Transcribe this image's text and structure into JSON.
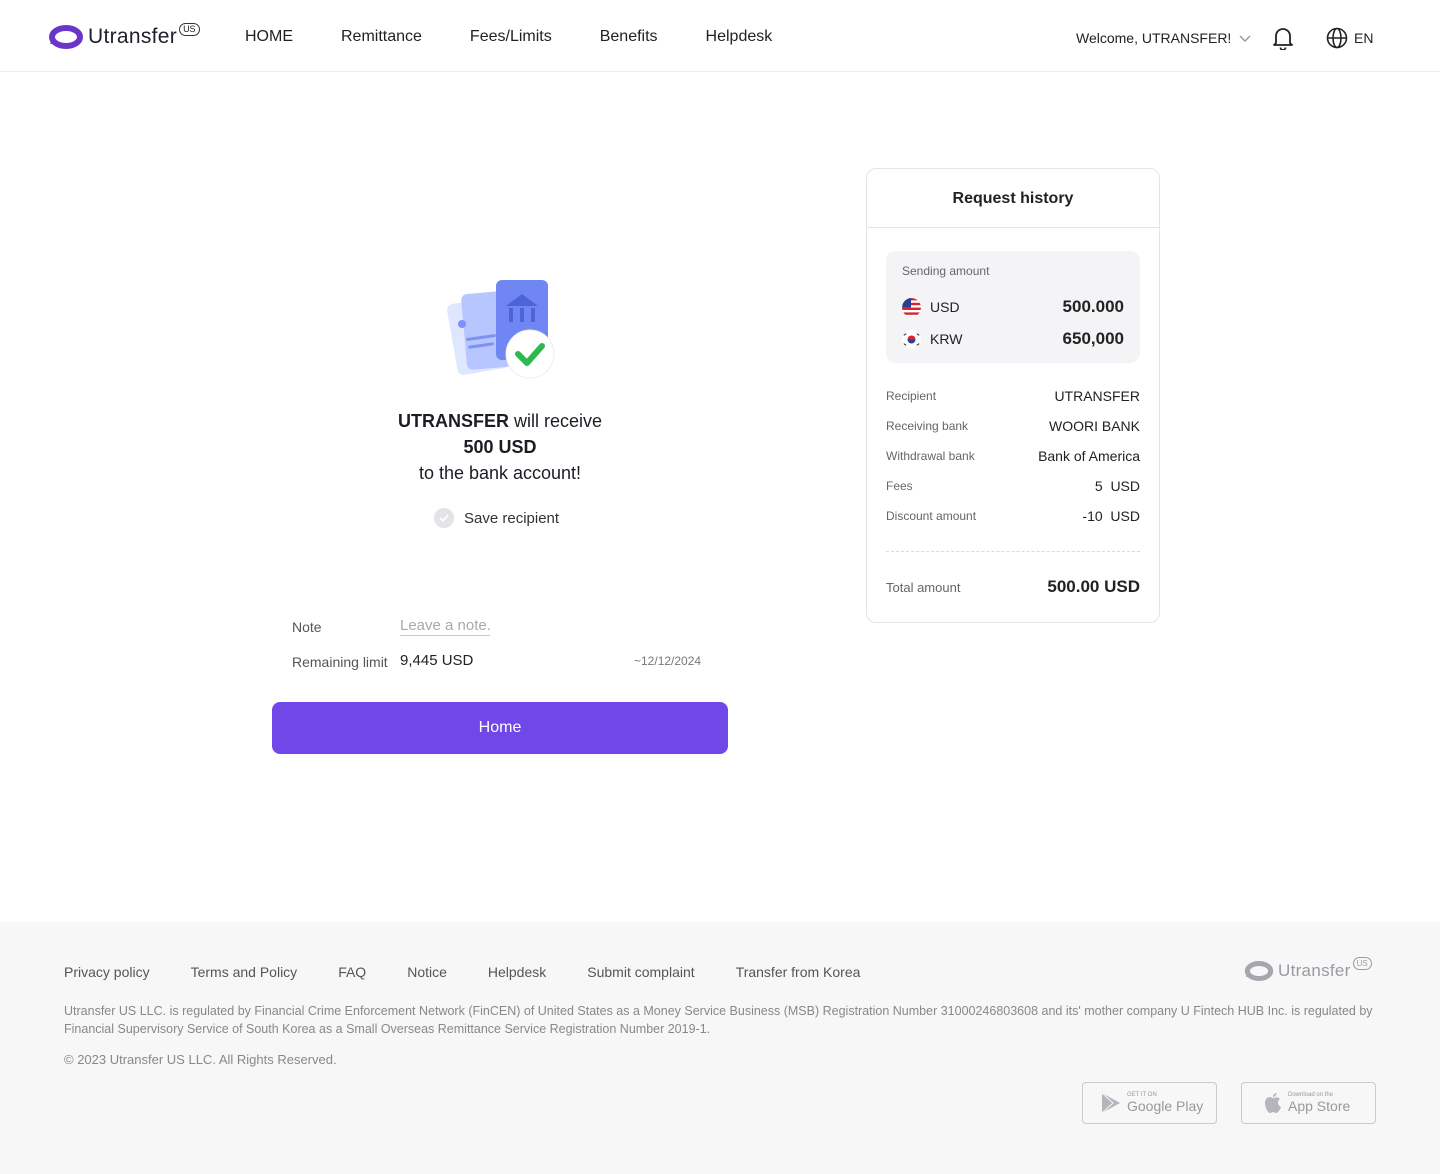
{
  "header": {
    "logo_text": "Utransfer",
    "logo_badge": "US",
    "nav": [
      "HOME",
      "Remittance",
      "Fees/Limits",
      "Benefits",
      "Helpdesk"
    ],
    "welcome": "Welcome, UTRANSFER!",
    "language": "EN"
  },
  "result": {
    "recipient_name": "UTRANSFER",
    "line1_rest": " will receive",
    "line2": "500 USD",
    "line3": "to the bank account!",
    "save_label": "Save recipient"
  },
  "form": {
    "note_label": "Note",
    "note_placeholder": "Leave a note.",
    "limit_label": "Remaining limit",
    "limit_value": "9,445 USD",
    "limit_date": "~12/12/2024",
    "home_button": "Home"
  },
  "history": {
    "title": "Request history",
    "sending_label": "Sending amount",
    "currencies": [
      {
        "code": "USD",
        "amount": "500.000"
      },
      {
        "code": "KRW",
        "amount": "650,000"
      }
    ],
    "details": [
      {
        "label": "Recipient",
        "value": "UTRANSFER"
      },
      {
        "label": "Receiving bank",
        "value": "WOORI BANK"
      },
      {
        "label": "Withdrawal bank",
        "value": "Bank of America"
      },
      {
        "label": "Fees",
        "value": "5  USD"
      },
      {
        "label": "Discount amount",
        "value": "-10  USD"
      }
    ],
    "total_label": "Total amount",
    "total_value": "500.00 USD"
  },
  "footer": {
    "links": [
      "Privacy policy",
      "Terms and Policy",
      "FAQ",
      "Notice",
      "Helpdesk",
      "Submit complaint",
      "Transfer from Korea"
    ],
    "logo_text": "Utransfer",
    "logo_badge": "US",
    "legal": "Utransfer US LLC. is regulated by Financial Crime Enforcement Network (FinCEN) of United States as a Money Service Business (MSB) Registration Number 31000246803608 and its' mother company U Fintech HUB Inc. is regulated by Financial Supervisory Service of South Korea as a Small Overseas Remittance Service Registration Number 2019-1.",
    "copyright": "© 2023 Utransfer US LLC. All Rights Reserved.",
    "google_small": "GET IT ON",
    "google_big": "Google Play",
    "apple_small": "Download on the",
    "apple_big": "App Store"
  },
  "colors": {
    "brand": "#6a35c8",
    "primary_button": "#7048e8",
    "check_green": "#2fb84f"
  },
  "icons": [
    "logo-icon",
    "chevron-down-icon",
    "bell-icon",
    "globe-icon",
    "check-icon",
    "us-flag-icon",
    "kr-flag-icon",
    "google-play-icon",
    "apple-icon"
  ]
}
